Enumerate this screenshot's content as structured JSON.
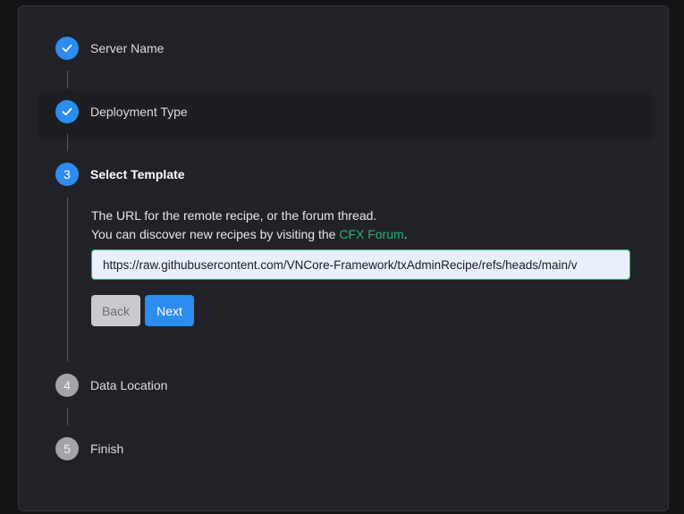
{
  "steps": [
    {
      "label": "Server Name",
      "status": "done",
      "icon": "check-icon"
    },
    {
      "label": "Deployment Type",
      "status": "done",
      "icon": "check-icon"
    },
    {
      "label": "Select Template",
      "status": "current",
      "number": "3"
    },
    {
      "label": "Data Location",
      "status": "pending",
      "number": "4"
    },
    {
      "label": "Finish",
      "status": "pending",
      "number": "5"
    }
  ],
  "template": {
    "desc_line1": "The URL for the remote recipe, or the forum thread.",
    "desc_line2_prefix": "You can discover new recipes by visiting the ",
    "forum_link": "CFX Forum",
    "desc_line2_suffix": ".",
    "url_value": "https://raw.githubusercontent.com/VNCore-Framework/txAdminRecipe/refs/heads/main/v",
    "back_label": "Back",
    "next_label": "Next"
  },
  "colors": {
    "accent": "#2d8cf0",
    "link": "#22b573",
    "pending": "#a3a3a8",
    "background": "#212227"
  }
}
